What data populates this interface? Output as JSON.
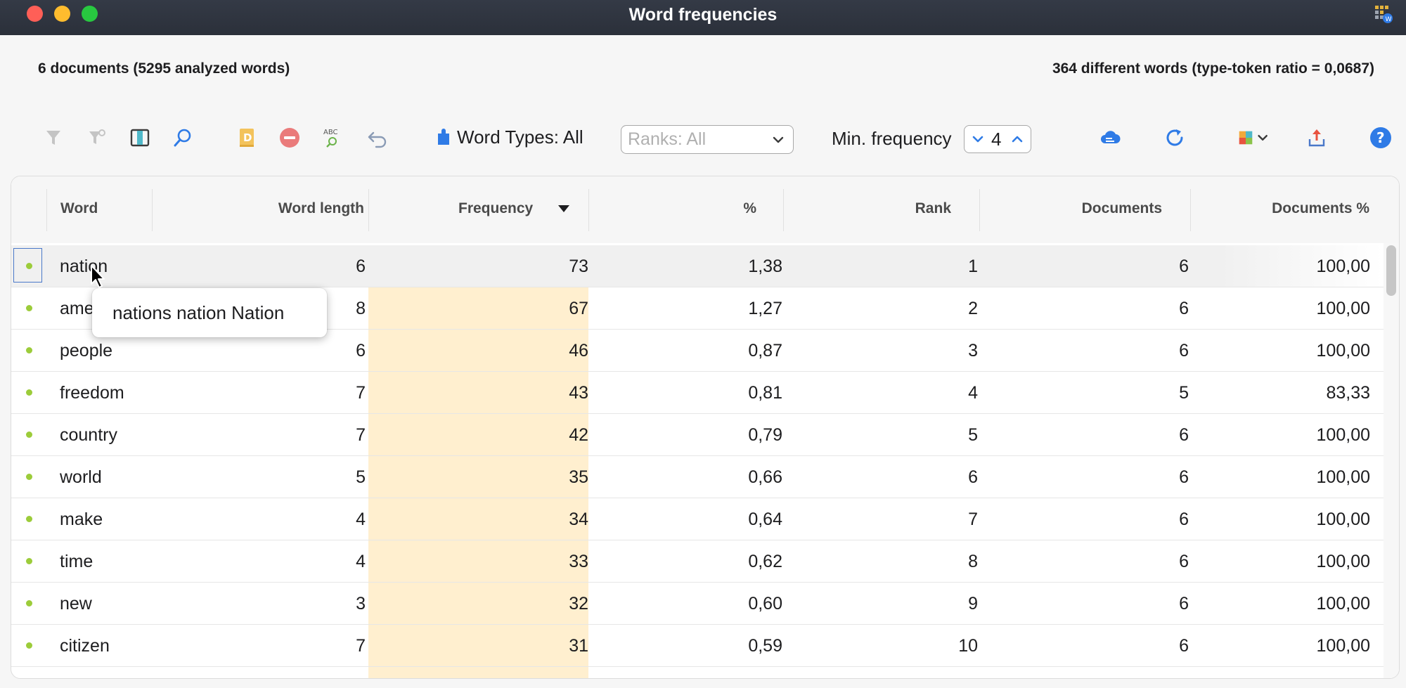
{
  "window": {
    "title": "Word frequencies"
  },
  "summary": {
    "left": "6 documents  (5295 analyzed words)",
    "right": "364 different words (type-token ratio = 0,0687)"
  },
  "toolbar": {
    "word_types_label": "Word Types: All",
    "ranks_placeholder": "Ranks: All",
    "min_frequency_label": "Min. frequency",
    "min_frequency_value": "4"
  },
  "colors": {
    "titlebar": "#2e3440",
    "accent_blue": "#2f7be6",
    "frequency_band": "#ffefcf",
    "status_dot": "#9ccc3a"
  },
  "table": {
    "sorted_column": "Frequency",
    "sort_direction": "descending",
    "columns": [
      "Word",
      "Word length",
      "Frequency",
      "%",
      "Rank",
      "Documents",
      "Documents %"
    ],
    "rows": [
      {
        "word": "nation",
        "length": "6",
        "freq": "73",
        "pct": "1,38",
        "rank": "1",
        "docs": "6",
        "docs_pct": "100,00"
      },
      {
        "word": "ame",
        "length": "8",
        "freq": "67",
        "pct": "1,27",
        "rank": "2",
        "docs": "6",
        "docs_pct": "100,00"
      },
      {
        "word": "people",
        "length": "6",
        "freq": "46",
        "pct": "0,87",
        "rank": "3",
        "docs": "6",
        "docs_pct": "100,00"
      },
      {
        "word": "freedom",
        "length": "7",
        "freq": "43",
        "pct": "0,81",
        "rank": "4",
        "docs": "5",
        "docs_pct": "83,33"
      },
      {
        "word": "country",
        "length": "7",
        "freq": "42",
        "pct": "0,79",
        "rank": "5",
        "docs": "6",
        "docs_pct": "100,00"
      },
      {
        "word": "world",
        "length": "5",
        "freq": "35",
        "pct": "0,66",
        "rank": "6",
        "docs": "6",
        "docs_pct": "100,00"
      },
      {
        "word": "make",
        "length": "4",
        "freq": "34",
        "pct": "0,64",
        "rank": "7",
        "docs": "6",
        "docs_pct": "100,00"
      },
      {
        "word": "time",
        "length": "4",
        "freq": "33",
        "pct": "0,62",
        "rank": "8",
        "docs": "6",
        "docs_pct": "100,00"
      },
      {
        "word": "new",
        "length": "3",
        "freq": "32",
        "pct": "0,60",
        "rank": "9",
        "docs": "6",
        "docs_pct": "100,00"
      },
      {
        "word": "citizen",
        "length": "7",
        "freq": "31",
        "pct": "0,59",
        "rank": "10",
        "docs": "6",
        "docs_pct": "100,00"
      }
    ]
  },
  "tooltip": {
    "text": "nations nation Nation"
  },
  "icons": [
    "funnel-icon",
    "funnel-settings-icon",
    "column-toggle-icon",
    "search-icon",
    "dictionary-icon",
    "remove-icon",
    "spellcheck-icon",
    "undo-icon",
    "word-types-icon",
    "cloud-icon",
    "refresh-icon",
    "color-palette-icon",
    "export-icon",
    "help-icon"
  ]
}
